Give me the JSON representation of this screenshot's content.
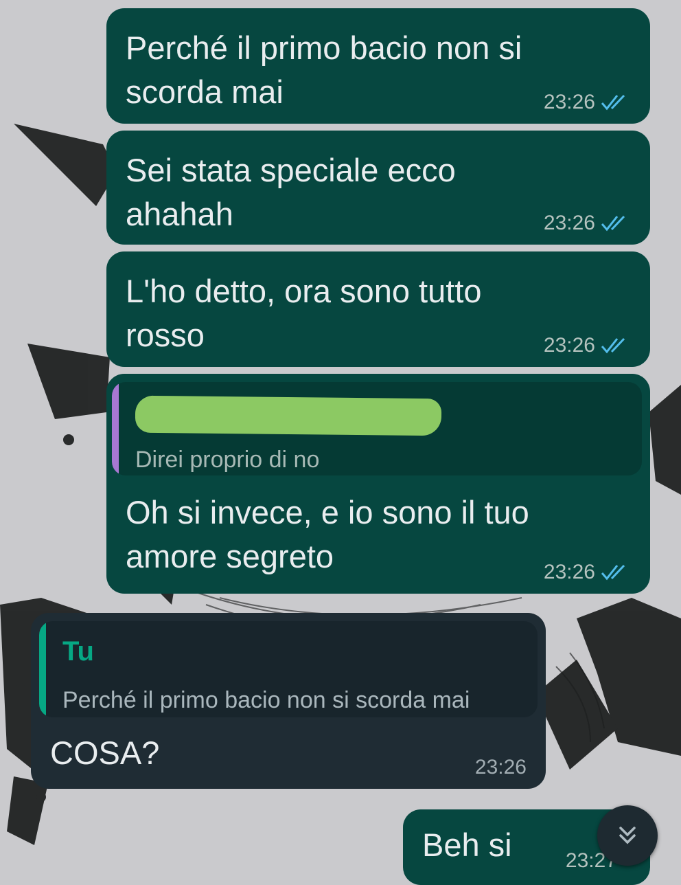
{
  "messages": [
    {
      "text": "Perché il primo bacio non si scorda mai",
      "time": "23:26"
    },
    {
      "text": "Sei stata speciale ecco ahahah",
      "time": "23:26"
    },
    {
      "text": "L'ho detto, ora sono tutto rosso",
      "time": "23:26"
    },
    {
      "reply_quote": "Direi proprio di no",
      "text": "Oh si invece, e io sono il tuo amore segreto",
      "time": "23:26"
    },
    {
      "reply_sender": "Tu",
      "reply_quote": "Perché il primo bacio non si scorda mai",
      "text": "COSA?",
      "time": "23:26"
    },
    {
      "text": "Beh si",
      "time": "23:27"
    }
  ],
  "colors": {
    "outgoing_bubble": "#064740",
    "incoming_bubble": "#1f2c34",
    "read_ticks": "#53bdeb",
    "quote_bar_purple": "#a878d3",
    "quote_bar_teal": "#06a884",
    "redaction": "#8cc963"
  },
  "icons": [
    "double-check-icon",
    "chevron-down-icon"
  ]
}
